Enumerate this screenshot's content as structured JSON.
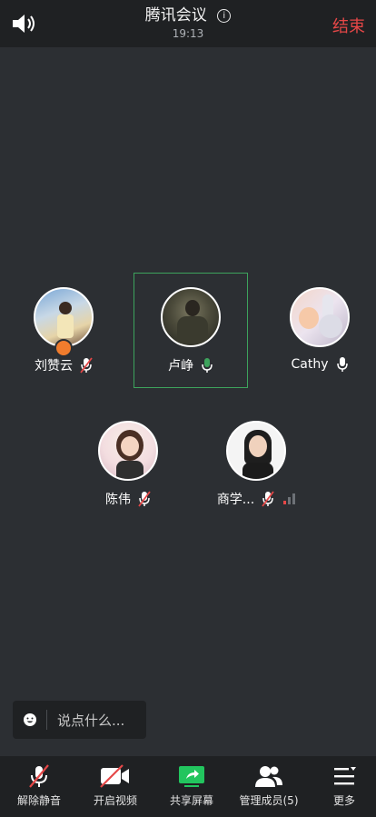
{
  "header": {
    "title": "腾讯会议",
    "time": "19:13",
    "end_label": "结束"
  },
  "participants": [
    {
      "name": "刘赞云",
      "mic": "muted",
      "host": true
    },
    {
      "name": "卢峥",
      "mic": "active",
      "speaking": true
    },
    {
      "name": "Cathy",
      "mic": "on"
    },
    {
      "name": "陈伟",
      "mic": "muted"
    },
    {
      "name": "商学...",
      "mic": "muted",
      "signal_bars_active": 1
    }
  ],
  "chat": {
    "placeholder": "说点什么..."
  },
  "toolbar": {
    "unmute": "解除静音",
    "video": "开启视频",
    "share": "共享屏幕",
    "members": "管理成员(5)",
    "more": "更多"
  },
  "colors": {
    "end": "#e54747",
    "active_green": "#3da35c",
    "share_green": "#22c55e",
    "muted_red": "#e54747"
  }
}
